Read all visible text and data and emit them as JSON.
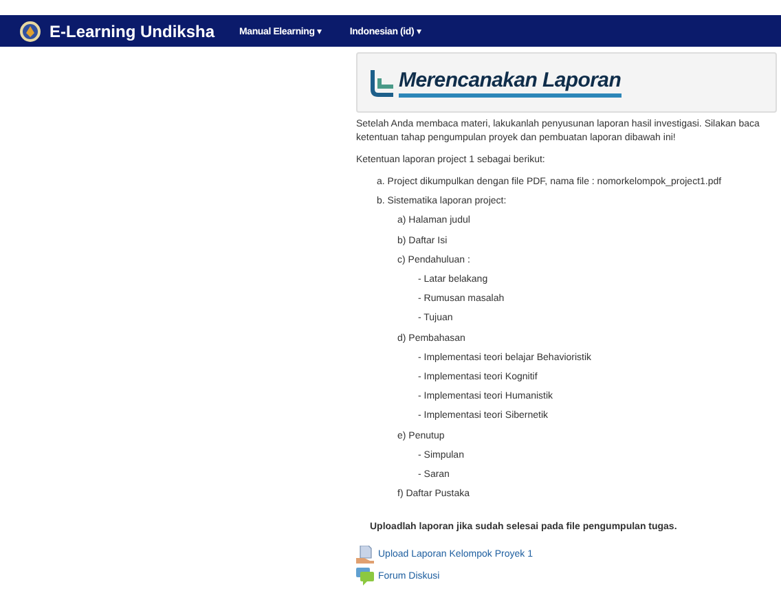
{
  "navbar": {
    "brand": "E-Learning Undiksha",
    "menus": [
      {
        "label": "Manual Elearning",
        "caret": "▾"
      },
      {
        "label": "Indonesian (id)",
        "caret": "▾"
      }
    ]
  },
  "banner": {
    "title": "Merencanakan Laporan"
  },
  "intro": [
    "Setelah Anda membaca materi, lakukanlah penyusunan laporan hasil investigasi. Silakan baca ketentuan tahap pengumpulan proyek dan pembuatan laporan dibawah ini!",
    "Ketentuan laporan project 1 sebagai berikut:"
  ],
  "outline": [
    {
      "text": "a. Project dikumpulkan dengan file PDF, nama file : nomorkelompok_project1.pdf"
    },
    {
      "text": "b. Sistematika laporan project:",
      "children": [
        {
          "text": "a) Halaman judul"
        },
        {
          "text": "b) Daftar Isi"
        },
        {
          "text": "c) Pendahuluan :",
          "children": [
            {
              "text": "-  Latar belakang"
            },
            {
              "text": "-  Rumusan masalah"
            },
            {
              "text": "-  Tujuan"
            }
          ]
        },
        {
          "text": "d) Pembahasan",
          "children": [
            {
              "text": "-   Implementasi teori belajar Behavioristik"
            },
            {
              "text": "-   Implementasi teori Kognitif"
            },
            {
              "text": "-   Implementasi teori Humanistik"
            },
            {
              "text": "-   Implementasi teori Sibernetik"
            }
          ]
        },
        {
          "text": "e) Penutup",
          "children": [
            {
              "text": "-   Simpulan"
            },
            {
              "text": "-   Saran"
            }
          ]
        },
        {
          "text": "f)  Daftar Pustaka"
        }
      ]
    }
  ],
  "note": "Uploadlah laporan jika sudah selesai pada file pengumpulan tugas.",
  "activities": [
    {
      "kind": "assignment",
      "label": "Upload Laporan Kelompok Proyek 1"
    },
    {
      "kind": "forum",
      "label": "Forum Diskusi"
    }
  ]
}
